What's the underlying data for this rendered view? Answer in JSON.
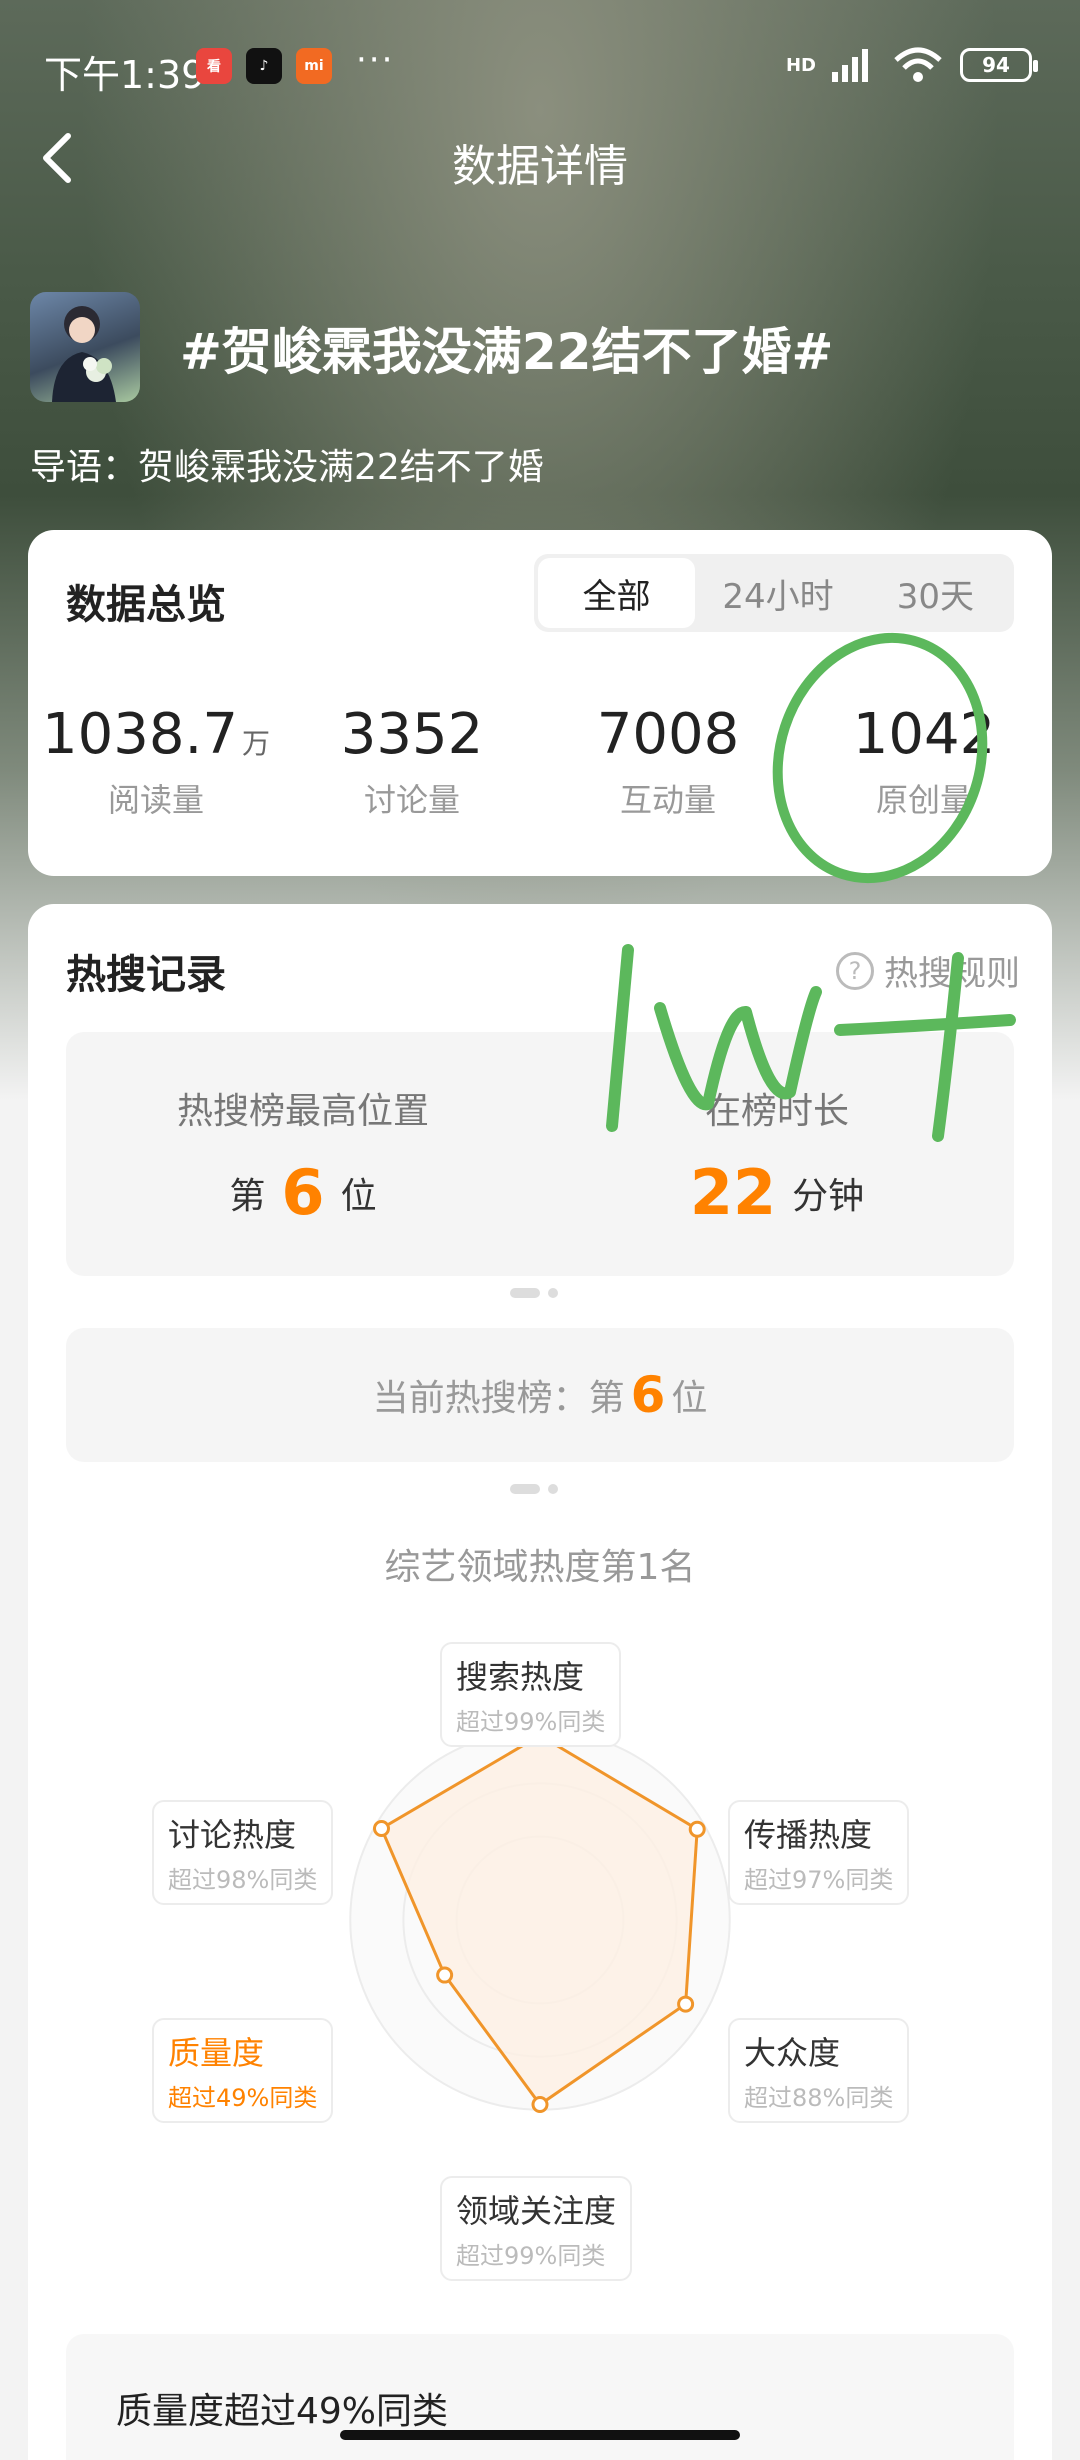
{
  "status_bar": {
    "time": "下午1:39",
    "app_icons": [
      "wenzhang-app-icon",
      "tiktok-icon",
      "mi-icon"
    ],
    "more": "···",
    "network": "HD",
    "battery": "94"
  },
  "nav": {
    "title": "数据详情"
  },
  "topic": {
    "title": "#贺峻霖我没满22结不了婚#",
    "guide": "导语：贺峻霖我没满22结不了婚"
  },
  "overview": {
    "title": "数据总览",
    "tabs": [
      {
        "label": "全部",
        "active": true
      },
      {
        "label": "24小时",
        "active": false
      },
      {
        "label": "30天",
        "active": false
      }
    ],
    "stats": [
      {
        "value": "1038.7",
        "unit": "万",
        "label": "阅读量"
      },
      {
        "value": "3352",
        "unit": "",
        "label": "讨论量"
      },
      {
        "value": "7008",
        "unit": "",
        "label": "互动量"
      },
      {
        "value": "1042",
        "unit": "",
        "label": "原创量"
      }
    ]
  },
  "hot_search": {
    "title": "热搜记录",
    "rule_label": "热搜规则",
    "highest": {
      "label": "热搜榜最高位置",
      "prefix": "第",
      "value": "6",
      "suffix": "位"
    },
    "duration": {
      "label": "在榜时长",
      "value": "22",
      "suffix": "分钟"
    },
    "current": {
      "prefix": "当前热搜榜：第",
      "value": "6",
      "suffix": "位"
    },
    "domain_rank": "综艺领域热度第1名",
    "radar": {
      "dimensions": [
        {
          "name": "搜索热度",
          "desc": "超过99%同类",
          "value": 0.99
        },
        {
          "name": "传播热度",
          "desc": "超过97%同类",
          "value": 0.97
        },
        {
          "name": "大众度",
          "desc": "超过88%同类",
          "value": 0.88
        },
        {
          "name": "领域关注度",
          "desc": "超过99%同类",
          "value": 0.99
        },
        {
          "name": "质量度",
          "desc": "超过49%同类",
          "value": 0.49,
          "highlight": true
        },
        {
          "name": "讨论热度",
          "desc": "超过98%同类",
          "value": 0.98
        }
      ],
      "line_color": "#f0952a",
      "fill_color": "#fdf0e4"
    },
    "quality_summary": "质量度超过49%同类"
  },
  "annotation": {
    "handwritten_text": "1w+",
    "color": "#5cb85c"
  }
}
